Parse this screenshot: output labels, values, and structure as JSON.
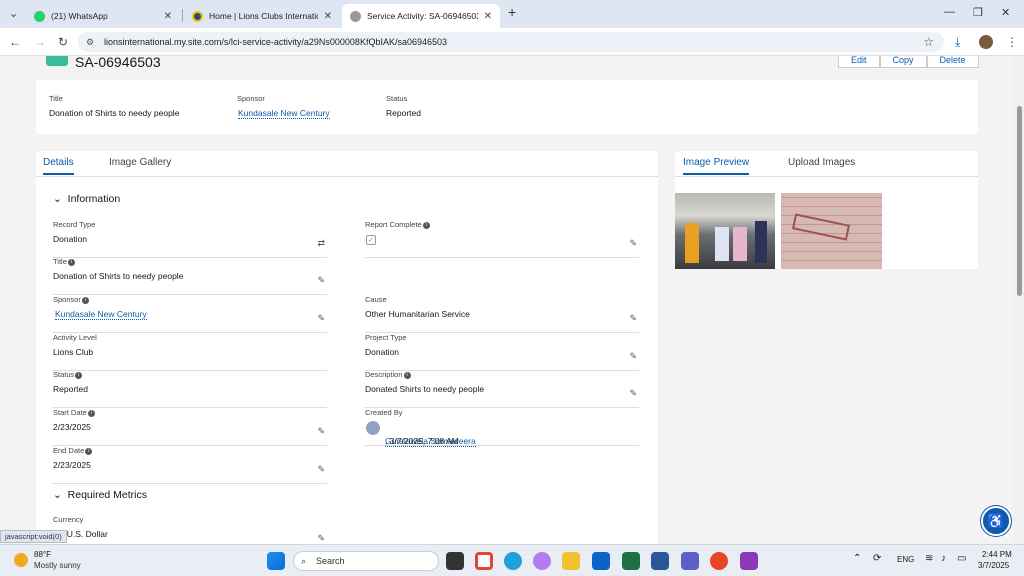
{
  "browser": {
    "tabs": [
      {
        "title": "(21) WhatsApp",
        "color": "#25d366"
      },
      {
        "title": "Home | Lions Clubs International",
        "color": "#1d4f91"
      },
      {
        "title": "Service Activity: SA-06946503",
        "color": "#777777"
      }
    ],
    "new_tab": "+",
    "url": "lionsinternational.my.site.com/s/lci-service-activity/a29Ns000008KfQbIAK/sa06946503"
  },
  "record": {
    "number": "SA-06946503",
    "actions": [
      "Edit",
      "Copy",
      "Delete"
    ],
    "highlights": [
      {
        "label": "Title",
        "value": "Donation of Shirts to needy people"
      },
      {
        "label": "Sponsor",
        "value": "Kundasale New Century"
      },
      {
        "label": "Status",
        "value": "Reported"
      }
    ]
  },
  "detail_tabs": [
    "Details",
    "Image Gallery"
  ],
  "sections": {
    "information": "Information",
    "metrics": "Required Metrics"
  },
  "left_fields": [
    {
      "label": "Record Type",
      "value": "Donation"
    },
    {
      "label": "Title",
      "value": "Donation of Shirts to needy people"
    },
    {
      "label": "Sponsor",
      "value": "Kundasale New Century"
    },
    {
      "label": "Activity Level",
      "value": "Lions Club"
    },
    {
      "label": "Status",
      "value": "Reported"
    },
    {
      "label": "Start Date",
      "value": "2/23/2025"
    },
    {
      "label": "End Date",
      "value": "2/23/2025"
    }
  ],
  "right_fields": [
    {
      "label": "Report Complete",
      "value": ""
    },
    {
      "label": "Cause",
      "value": "Other Humanitarian Service"
    },
    {
      "label": "Project Type",
      "value": "Donation"
    },
    {
      "label": "Description",
      "value": "Donated Shirts to needy people"
    },
    {
      "label": "Created By",
      "value": "Guralawela Somaweera",
      "extra": ", 3/7/2025, 7:08 AM"
    }
  ],
  "metrics": {
    "label": "Currency",
    "value": "D - U.S. Dollar"
  },
  "image_tabs": [
    "Image Preview",
    "Upload Images"
  ],
  "statusbar": "javascript:void(0)",
  "taskbar": {
    "temp": "88°F",
    "weather": "Mostly sunny",
    "search": "Search",
    "lang": "ENG",
    "time": "2:44 PM",
    "date": "3/7/2025"
  }
}
